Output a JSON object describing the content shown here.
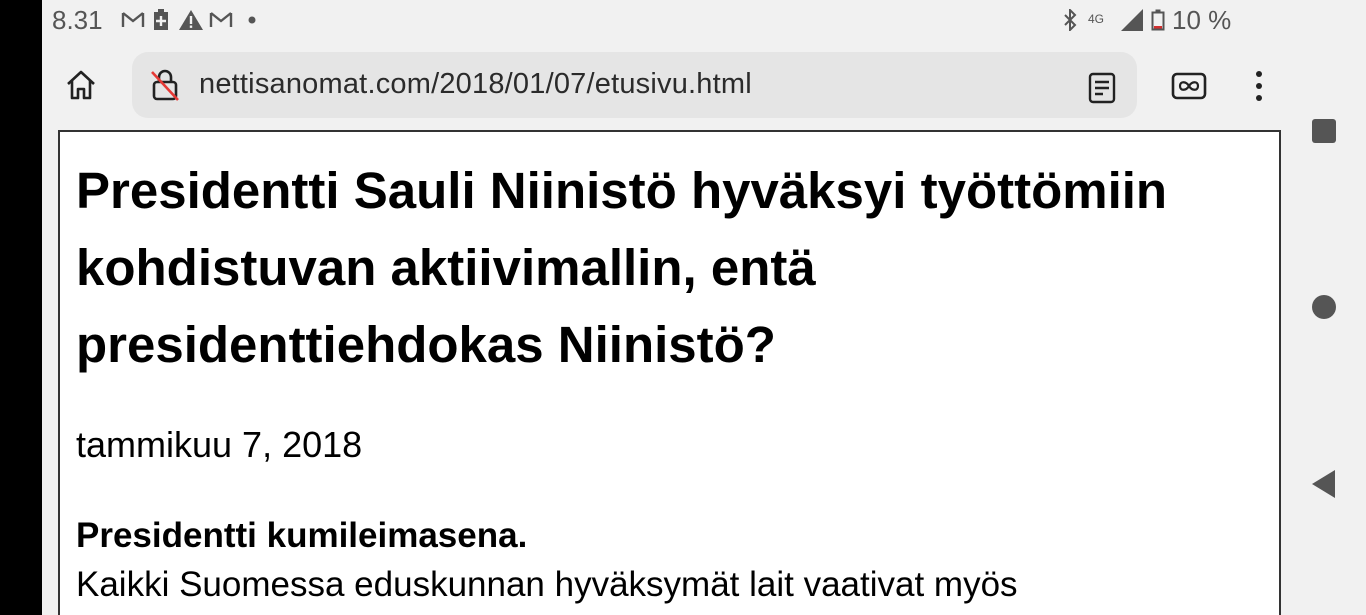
{
  "status_bar": {
    "time": "8.31",
    "network": "4G",
    "battery": "10 %",
    "icons": [
      "gmail-icon",
      "battery-saver-icon",
      "warning-icon",
      "gmail-icon",
      "dot-icon",
      "bluetooth-icon",
      "signal-icon",
      "battery-icon"
    ]
  },
  "browser": {
    "url": "nettisanomat.com/2018/01/07/etusivu.html",
    "icons": {
      "home": "home-icon",
      "lock": "not-secure-icon",
      "reader": "reader-mode-icon",
      "tabs": "tab-switcher-icon",
      "menu": "more-vert-icon"
    }
  },
  "article": {
    "headline": "Presidentti Sauli Niinistö hyväksyi työttömiin kohdistuvan aktiivimallin, entä presidenttiehdokas Niinistö?",
    "date": "tammikuu 7, 2018",
    "lead_bold": "Presidentti kumileimasena.",
    "body": "Kaikki Suomessa eduskunnan hyväksymät lait vaativat myös"
  },
  "nav": {
    "icons": [
      "recents-icon",
      "home-circle-icon",
      "back-icon"
    ]
  },
  "colors": {
    "chrome_bg": "#f1f1f1",
    "url_bar_bg": "#e5e5e5",
    "text": "#000000",
    "icon": "#555555"
  }
}
